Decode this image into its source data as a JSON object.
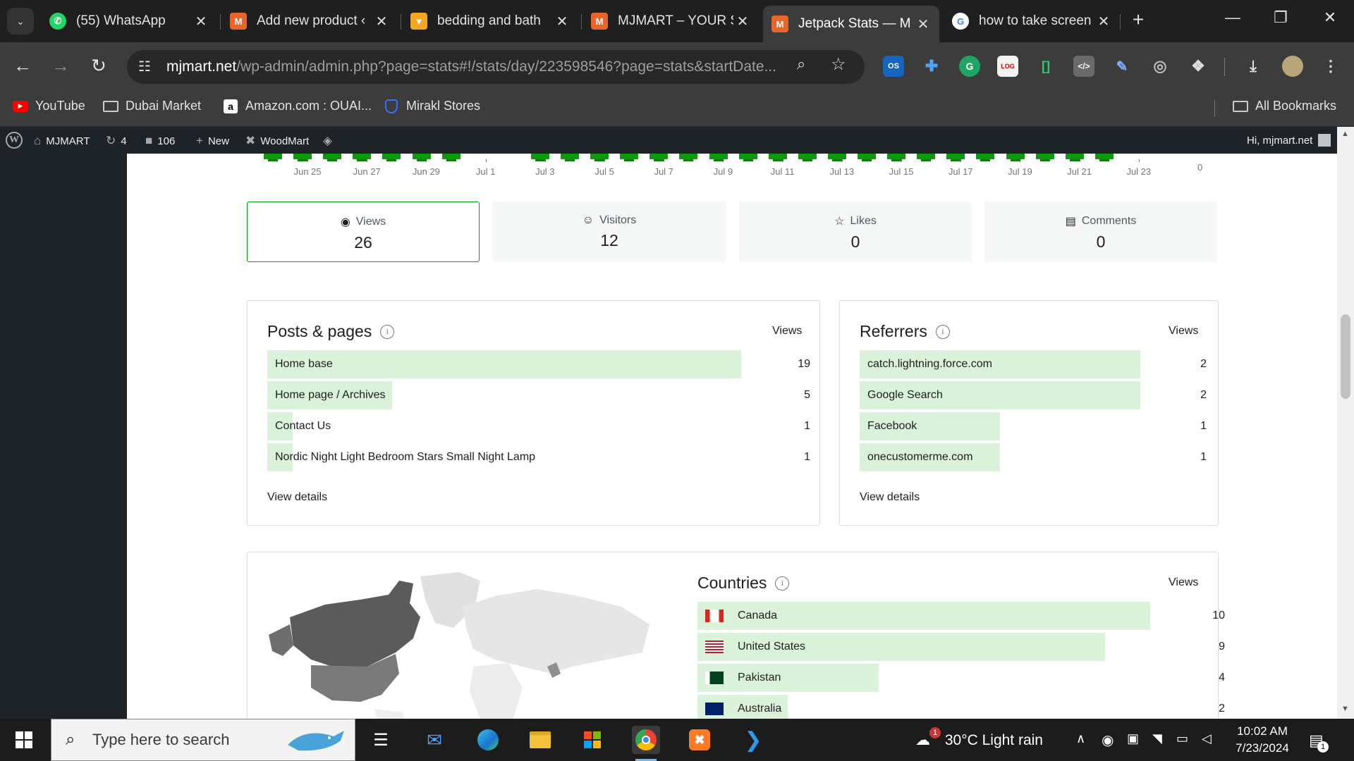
{
  "browser": {
    "tabs": [
      {
        "title": "(55) WhatsApp",
        "icon": "whatsapp-icon",
        "color": "#25d366"
      },
      {
        "title": "Add new product ‹",
        "icon": "mjmart-favicon",
        "color": "#e8662a"
      },
      {
        "title": "bedding and bath",
        "icon": "bedding-favicon",
        "color": "#f5a623"
      },
      {
        "title": "MJMART – YOUR S",
        "icon": "mjmart-favicon",
        "color": "#e8662a"
      },
      {
        "title": "Jetpack Stats — M",
        "icon": "mjmart-favicon",
        "color": "#e8662a",
        "active": true
      },
      {
        "title": "how to take screen",
        "icon": "google-icon",
        "color": "#4285f4"
      }
    ],
    "url_host": "mjmart.net",
    "url_path": "/wp-admin/admin.php?page=stats#!/stats/day/223598546?page=stats&startDate...",
    "bookmarks": [
      {
        "label": "YouTube",
        "icon": "youtube-icon"
      },
      {
        "label": "Dubai Market",
        "icon": "folder-icon"
      },
      {
        "label": "Amazon.com : OUAI...",
        "icon": "amazon-icon"
      },
      {
        "label": "Mirakl Stores",
        "icon": "mirakl-icon"
      }
    ],
    "all_bookmarks": "All Bookmarks"
  },
  "adminbar": {
    "site": "MJMART",
    "updates": "4",
    "comments": "106",
    "new": "New",
    "woodmart": "WoodMart",
    "greeting": "Hi, mjmart.net"
  },
  "chart_data": {
    "type": "bar",
    "x_ticks": [
      "Jun 25",
      "Jun 27",
      "Jun 29",
      "Jul 1",
      "Jul 3",
      "Jul 5",
      "Jul 7",
      "Jul 9",
      "Jul 11",
      "Jul 13",
      "Jul 15",
      "Jul 17",
      "Jul 19",
      "Jul 21",
      "Jul 23"
    ],
    "y_min_label": "0",
    "bar_color": "#0b9a0b"
  },
  "stats": {
    "views": {
      "label": "Views",
      "value": "26"
    },
    "visitors": {
      "label": "Visitors",
      "value": "12"
    },
    "likes": {
      "label": "Likes",
      "value": "0"
    },
    "comments": {
      "label": "Comments",
      "value": "0"
    }
  },
  "posts": {
    "title": "Posts & pages",
    "col": "Views",
    "rows": [
      {
        "label": "Home base",
        "value": "19",
        "fraction": 1.0
      },
      {
        "label": "Home page / Archives",
        "value": "5",
        "fraction": 0.263
      },
      {
        "label": "Contact Us",
        "value": "1",
        "fraction": 0.053
      },
      {
        "label": "Nordic Night Light Bedroom Stars Small Night Lamp",
        "value": "1",
        "fraction": 0.053
      }
    ],
    "details": "View details"
  },
  "referrers": {
    "title": "Referrers",
    "col": "Views",
    "rows": [
      {
        "label": "catch.lightning.force.com",
        "value": "2",
        "fraction": 1.0
      },
      {
        "label": "Google Search",
        "value": "2",
        "fraction": 1.0
      },
      {
        "label": "Facebook",
        "value": "1",
        "fraction": 0.5
      },
      {
        "label": "onecustomerme.com",
        "value": "1",
        "fraction": 0.5
      }
    ],
    "details": "View details"
  },
  "countries": {
    "title": "Countries",
    "col": "Views",
    "rows": [
      {
        "label": "Canada",
        "value": "10",
        "fraction": 1.0,
        "flag": "canada"
      },
      {
        "label": "United States",
        "value": "9",
        "fraction": 0.9,
        "flag": "usa"
      },
      {
        "label": "Pakistan",
        "value": "4",
        "fraction": 0.4,
        "flag": "pakistan"
      },
      {
        "label": "Australia",
        "value": "2",
        "fraction": 0.2,
        "flag": "australia"
      }
    ]
  },
  "taskbar": {
    "search_placeholder": "Type here to search",
    "weather": "30°C  Light rain",
    "time": "10:02 AM",
    "date": "7/23/2024",
    "notif_count": "1",
    "weather_badge": "1"
  }
}
